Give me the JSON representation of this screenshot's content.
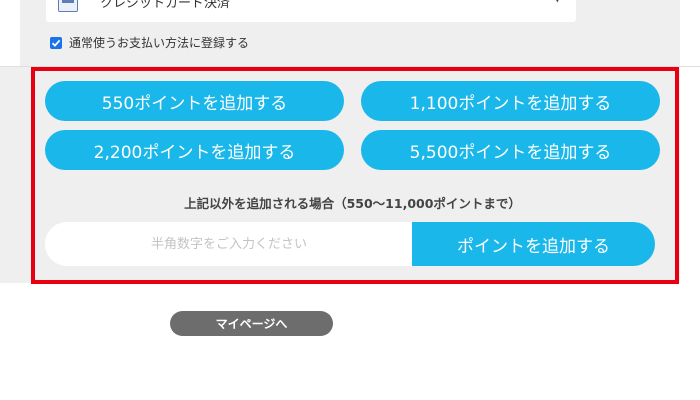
{
  "payment": {
    "selected_method": "クレジットカード決済",
    "card_icon": "credit-card-icon",
    "dropdown_icon": "chevron-down-icon",
    "save_default_checked": true,
    "save_default_label": "通常使うお支払い方法に登録する"
  },
  "points": {
    "buttons": [
      {
        "label": "550ポイントを追加する"
      },
      {
        "label": "1,100ポイントを追加する"
      },
      {
        "label": "2,200ポイントを追加する"
      },
      {
        "label": "5,500ポイントを追加する"
      }
    ],
    "custom_note": "上記以外を追加される場合（550〜11,000ポイントまで）",
    "custom_input_value": "",
    "custom_input_placeholder": "半角数字をご入力ください",
    "custom_submit_label": "ポイントを追加する"
  },
  "nav": {
    "mypage_label": "マイページへ"
  },
  "colors": {
    "accent": "#1ab7ea",
    "highlight_frame": "#e60012",
    "panel_bg": "#efefef",
    "mypage_button": "#6d6d6d"
  }
}
